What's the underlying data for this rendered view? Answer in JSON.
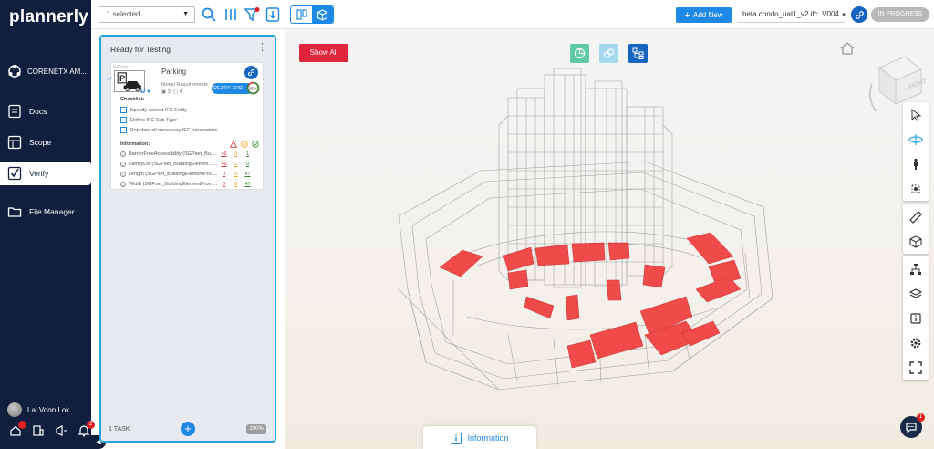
{
  "app": {
    "logo": "plannerly",
    "company": "CORENETX AM..."
  },
  "nav": [
    {
      "label": "Docs",
      "icon": "document-icon"
    },
    {
      "label": "Scope",
      "icon": "layout-icon"
    },
    {
      "label": "Verify",
      "icon": "checkbox-icon",
      "active": true
    },
    {
      "label": "File Manager",
      "icon": "folder-icon"
    }
  ],
  "user": {
    "name": "Lai Voon Lok"
  },
  "notifications": {
    "alerts": "2",
    "chat": "1"
  },
  "toolbar": {
    "selection": "1 selected",
    "add_new": "Add New",
    "model": "beta condo_uat1_v2.ifc",
    "version": "V004",
    "status": "IN PROGRESS"
  },
  "panel": {
    "title": "Ready for Testing",
    "footer": "1 TASK",
    "percent": "100%",
    "card": {
      "title": "Parking",
      "subtitle": "Model Requirements",
      "tag": "NoTask",
      "count_a": "3",
      "count_b": "4",
      "number": "47",
      "status": "READY FOR...",
      "progress_label": "85%",
      "progress": 0.85,
      "checklist_title": "Checklist:",
      "checklist": [
        "Specify correct IFC Entity",
        "Define IFC Sub Type",
        "Populate all necessary IFC parameters"
      ],
      "info_title": "Information:",
      "info": [
        {
          "label": "BarrierFreeAccessibility (SGPset_Bu.../...",
          "a": "46",
          "b": "0",
          "c": "1"
        },
        {
          "label": "FamilyLot (SGPset_BuildingElemen...Tr...",
          "a": "46",
          "b": "1",
          "c": "0"
        },
        {
          "label": "Length (SGPset_BuildingElementPro... m...",
          "a": "0",
          "b": "0",
          "c": "47"
        },
        {
          "label": "Width (SGPset_BuildingElementProx... m...",
          "a": "0",
          "b": "0",
          "c": "47"
        }
      ]
    }
  },
  "viewer": {
    "show_all": "Show All",
    "cube_face": "RIGHT",
    "info_tab": "Information",
    "highlight_color": "#f03a3a"
  },
  "colors": {
    "sidebar": "#0f1f3d",
    "accent": "#1e88e5",
    "panel_border": "#29a3e0",
    "danger": "#e0243a"
  }
}
